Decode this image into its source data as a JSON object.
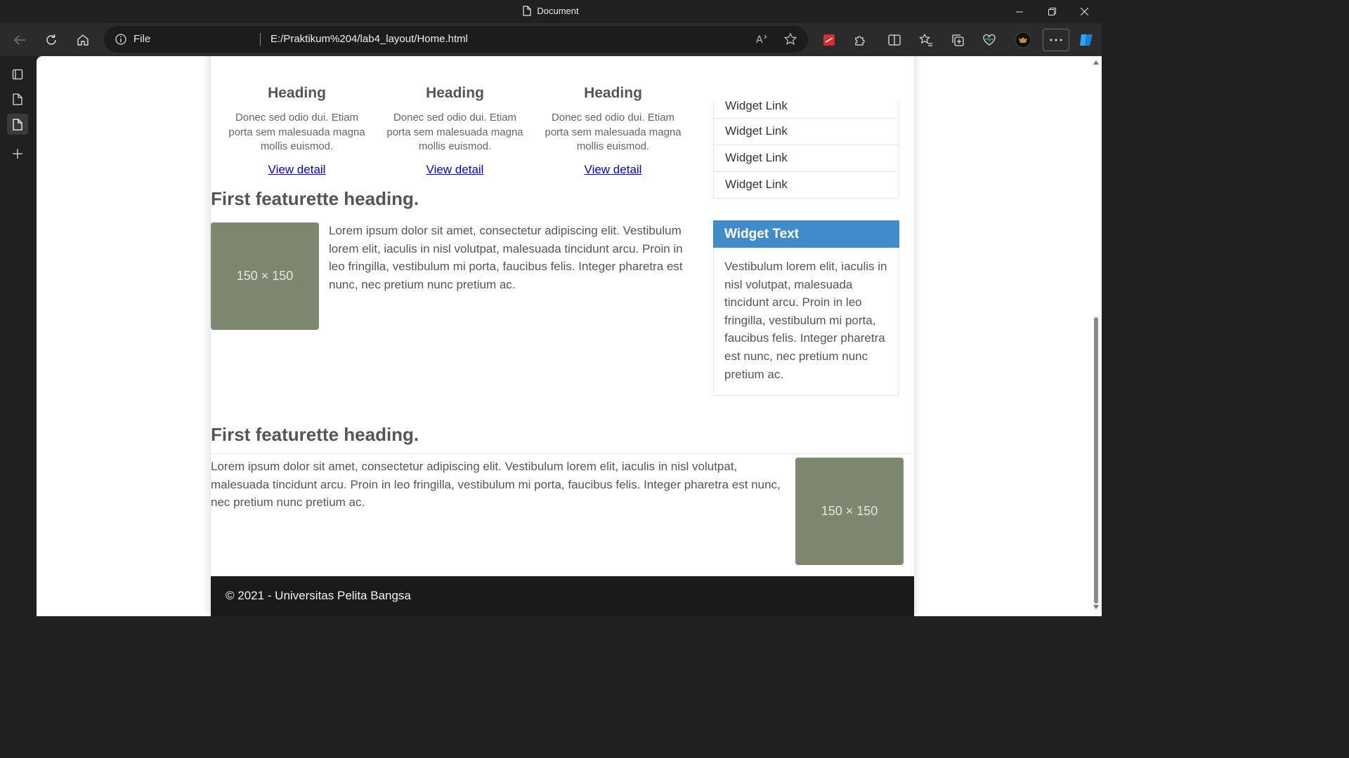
{
  "window": {
    "title": "Document"
  },
  "toolbar": {
    "file_label": "File",
    "url": "E:/Praktikum%204/lab4_layout/Home.html",
    "accent_color": "#2b2b2b"
  },
  "page": {
    "columns": [
      {
        "color": "#e07a26",
        "heading": "Heading",
        "text": "Donec sed odio dui. Etiam porta sem malesuada magna mollis euismod.",
        "link": "View detail"
      },
      {
        "color": "#3f72e5",
        "heading": "Heading",
        "text": "Donec sed odio dui. Etiam porta sem malesuada magna mollis euismod.",
        "link": "View detail"
      },
      {
        "color": "#6fe6d0",
        "heading": "Heading",
        "text": "Donec sed odio dui. Etiam porta sem malesuada magna mollis euismod.",
        "link": "View detail"
      }
    ],
    "featurette1": {
      "heading": "First featurette heading.",
      "image_label": "150 × 150",
      "text": "Lorem ipsum dolor sit amet, consectetur adipiscing elit. Vestibulum lorem elit, iaculis in nisl volutpat, malesuada tincidunt arcu. Proin in leo fringilla, vestibulum mi porta, faucibus felis. Integer pharetra est nunc, nec pretium nunc pretium ac."
    },
    "featurette2": {
      "heading": "First featurette heading.",
      "image_label": "150 × 150",
      "text": "Lorem ipsum dolor sit amet, consectetur adipiscing elit. Vestibulum lorem elit, iaculis in nisl volutpat, malesuada tincidunt arcu. Proin in leo fringilla, vestibulum mi porta, faucibus felis. Integer pharetra est nunc, nec pretium nunc pretium ac."
    },
    "sidebar": {
      "links": [
        "Widget Link",
        "Widget Link",
        "Widget Link",
        "Widget Link"
      ],
      "widget_title": "Widget Text",
      "widget_body": "Vestibulum lorem elit, iaculis in nisl volutpat, malesuada tincidunt arcu. Proin in leo fringilla, vestibulum mi porta, faucibus felis. Integer pharetra est nunc, nec pretium nunc pretium ac.",
      "widget_color": "#428bca"
    },
    "footer": "© 2021 - Universitas Pelita Bangsa"
  }
}
